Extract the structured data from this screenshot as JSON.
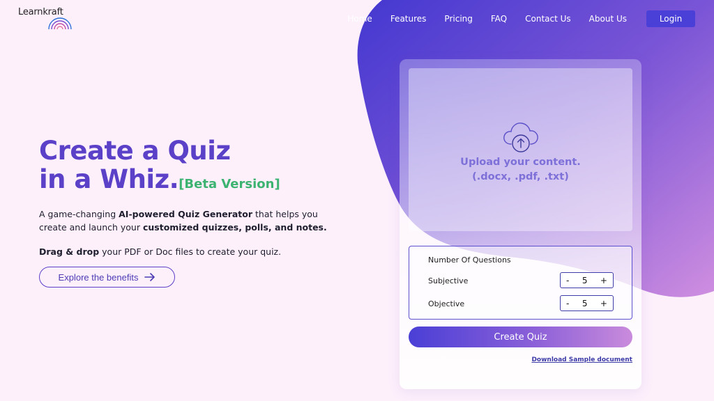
{
  "brand": {
    "name": "Learnkraft"
  },
  "nav": {
    "items": [
      "Home",
      "Features",
      "Pricing",
      "FAQ",
      "Contact Us",
      "About Us"
    ],
    "login_label": "Login"
  },
  "hero": {
    "title_line1": "Create a Quiz",
    "title_line2": "in a Whiz.",
    "beta_label": "[Beta Version]",
    "desc_part1": "A game-changing ",
    "desc_bold1": "AI-powered Quiz Generator",
    "desc_part2": " that helps you create and launch your ",
    "desc_bold2": "customized quizzes, polls, and notes.",
    "drag_bold": "Drag & drop",
    "drag_rest": " your PDF or Doc files to create your quiz.",
    "explore_label": "Explore the benefits"
  },
  "card": {
    "upload_line1": "Upload your content.",
    "upload_line2": "(.docx, .pdf, .txt)",
    "questions_title": "Number Of Questions",
    "subjective_label": "Subjective",
    "subjective_value": "5",
    "objective_label": "Objective",
    "objective_value": "5",
    "minus": "-",
    "plus": "+",
    "create_label": "Create Quiz",
    "download_label": "Download Sample document"
  },
  "colors": {
    "accent": "#5b40c8",
    "beta": "#3cb371",
    "login_bg": "#4a3fd6",
    "background": "#fdf0fb"
  },
  "icons": {
    "logo": "rainbow-arcs-icon",
    "upload": "cloud-upload-icon",
    "explore": "arrow-right-icon"
  }
}
